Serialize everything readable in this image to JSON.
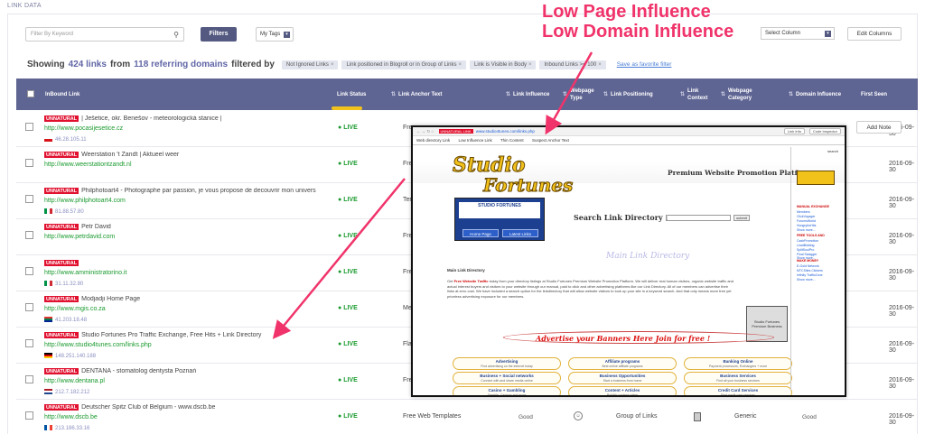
{
  "section_label": "LINK DATA",
  "toolbar": {
    "search_placeholder": "Filter By Keyword",
    "filters_label": "Filters",
    "mytags_label": "My Tags",
    "select_column_label": "Select Column",
    "edit_columns_label": "Edit Columns"
  },
  "summary": {
    "showing": "Showing",
    "links_count": "424 links",
    "from": "from",
    "domains_count": "118 referring domains",
    "filtered_by": "filtered by",
    "chips": [
      "Not Ignored Links",
      "Link positioned in Blogroll or in Group of Links",
      "Link is Visible in Body",
      "Inbound Links >= 100"
    ],
    "save_favorite": "Save as favorite filter"
  },
  "table": {
    "headers": {
      "inbound": "InBound Link",
      "status": "Link Status",
      "anchor": "Link Anchor Text",
      "influence": "Link Influence",
      "ptype": "Webpage Type",
      "positioning": "Link Positioning",
      "context": "Link Context",
      "category": "Webpage Category",
      "dinfluence": "Domain Influence",
      "firstseen": "First Seen"
    },
    "add_note": "Add Note",
    "rows": [
      {
        "badge": "UNNATURAL",
        "title": "| Ješetice, okr. Benešov - meteorologická stanice |",
        "url": "http://www.pocasijesetice.cz",
        "ip": "46.28.105.11",
        "flag": "cz",
        "status": "LIVE",
        "anchor": "Fre",
        "influence": "",
        "positioning": "",
        "category": "",
        "dinfluence": "",
        "seen": "2016-09-30"
      },
      {
        "badge": "UNNATURAL",
        "title": "Weerstation 't Zandt | Aktueel weer",
        "url": "http://www.weerstationtzandt.nl",
        "ip": "",
        "flag": "",
        "status": "LIVE",
        "anchor": "Fre",
        "influence": "",
        "positioning": "",
        "category": "",
        "dinfluence": "",
        "seen": "2016-09-30"
      },
      {
        "badge": "UNNATURAL",
        "title": "Philphotoart4 - Photographe par passion, je vous propose de decouvrir mon univers",
        "url": "http://www.philphotoart4.com",
        "ip": "81.88.57.80",
        "flag": "it",
        "status": "LIVE",
        "anchor": "Ter",
        "influence": "",
        "positioning": "",
        "category": "",
        "dinfluence": "",
        "seen": "2016-09-30"
      },
      {
        "badge": "UNNATURAL",
        "title": "Petr David",
        "url": "http://www.petrdavid.com",
        "ip": "",
        "flag": "",
        "status": "LIVE",
        "anchor": "Fre",
        "influence": "",
        "positioning": "",
        "category": "",
        "dinfluence": "",
        "seen": "2016-09-30"
      },
      {
        "badge": "UNNATURAL",
        "title": "",
        "url": "http://www.amministratorino.it",
        "ip": "31.11.32.80",
        "flag": "it",
        "status": "LIVE",
        "anchor": "Fre",
        "influence": "",
        "positioning": "",
        "category": "",
        "dinfluence": "",
        "seen": "2016-09-30"
      },
      {
        "badge": "UNNATURAL",
        "title": "Modjadji Home Page",
        "url": "http://www.mgis.co.za",
        "ip": "41.203.18.48",
        "flag": "za",
        "status": "LIVE",
        "anchor": "Me",
        "influence": "",
        "positioning": "",
        "category": "",
        "dinfluence": "",
        "seen": "2016-09-30"
      },
      {
        "badge": "UNNATURAL",
        "title": "Studio Fortunes Pro Traffic Exchange, Free Hits + Link Directory",
        "url": "http://www.studio4tunes.com/links.php",
        "ip": "148.251.140.188",
        "flag": "de",
        "status": "LIVE",
        "anchor": "Fla",
        "influence": "",
        "positioning": "",
        "category": "",
        "dinfluence": "",
        "seen": "2016-09-30"
      },
      {
        "badge": "UNNATURAL",
        "title": "DENTANA - stomatolog dentysta Poznań",
        "url": "http://www.dentana.pl",
        "ip": "212.7.182.212",
        "flag": "nl",
        "status": "LIVE",
        "anchor": "Fre",
        "influence": "",
        "positioning": "",
        "category": "",
        "dinfluence": "",
        "seen": "2016-09-30"
      },
      {
        "badge": "UNNATURAL",
        "title": "Deutscher Spitz Club of Belgium - www.dscb.be",
        "url": "http://www.dscb.be",
        "ip": "213.186.33.16",
        "flag": "fr",
        "status": "LIVE",
        "anchor": "Free Web Templates",
        "influence": "Good",
        "positioning": "Group of Links",
        "category": "Generic",
        "dinfluence": "Good",
        "seen": "2016-09-30"
      }
    ]
  },
  "overlay": {
    "badge": "UNNATURAL LINK",
    "url": "www.studio4tunes.com/links.php",
    "btn_info": "Link Info",
    "btn_inspector": "Code Inspector",
    "tabs": [
      "Web directory Link",
      "Low Influence Link",
      "Thin Content",
      "Suspect Anchor Text"
    ],
    "logo_line1": "Studio",
    "logo_line2": "Fortunes",
    "tagline": "Premium Website Promotion Platform.",
    "banner_title": "STUDIO FORTUNES",
    "banner_btn1": "Home Page",
    "banner_btn2": "Latest Links",
    "search_label": "Search Link Directory :",
    "submit": "submit",
    "main_dir": "Main Link Directory",
    "para_heading": "Main Link Directory",
    "para_prefix": "Get",
    "para_highlight": "Free Website Traffic",
    "para_text": "today from your directory listings at Studio Fortunes Premium Website Promotion Platform. We will deliver real human visitors, organic website traffic and actual interest buyers and visitors to your website through our manual, paid to click and other advertising platforms like our Link Directory. All of our members can advertise their links at zero cost. We have included a search option for the linkdirectory that will allow website visitors to look up your site in a keyword search. And that only means more free yet priceless advertising exposure for our members.",
    "biz_label": "Studio Fortunes Premium Business",
    "ribbon": "Advertise your Banners Here Join for free !",
    "categories": [
      {
        "name": "Advertising",
        "sub": "Find advertising on the internet today"
      },
      {
        "name": "Affiliate programs",
        "sub": "Best online affiliate programs"
      },
      {
        "name": "Banking Online",
        "sub": "Payment processors, Exchangers + more"
      },
      {
        "name": "Business + Social networks",
        "sub": "Connect with and share media online"
      },
      {
        "name": "Business Opportunities",
        "sub": "Start a business from home"
      },
      {
        "name": "Business Services",
        "sub": "Find all your business services"
      },
      {
        "name": "Casino + Gambling",
        "sub": "Gamble, Casinos and more"
      },
      {
        "name": "Content + Articles",
        "sub": "Publish content online"
      },
      {
        "name": "Credit Card Services",
        "sub": "Find credit card services"
      }
    ],
    "sidebar_search": "search",
    "sidebar_groups": [
      "MANUAL EXCHANGE",
      "FREE TOOLS AND",
      "MAKE MONEY"
    ],
    "sidebar_items": [
      "Members",
      "ClickVoyager",
      "ForumsWorld",
      "HungryforHits",
      "Show more...",
      "CashPromotion",
      "LeadBidding",
      "SplitSoulPro",
      "Final Swagger",
      "Show more...",
      "E-Gold Network",
      "MTCSites Clickers",
      "Infinity TrafficZone",
      "Show more..."
    ]
  },
  "annotations": {
    "line1": "Low Page Influence",
    "line2": "Low Domain Influence"
  },
  "colors": {
    "header_bg": "#5f6593",
    "accent": "#6166a6",
    "unnatural": "#e0102e",
    "live": "#1a9a2e",
    "annotation": "#f0336a"
  }
}
